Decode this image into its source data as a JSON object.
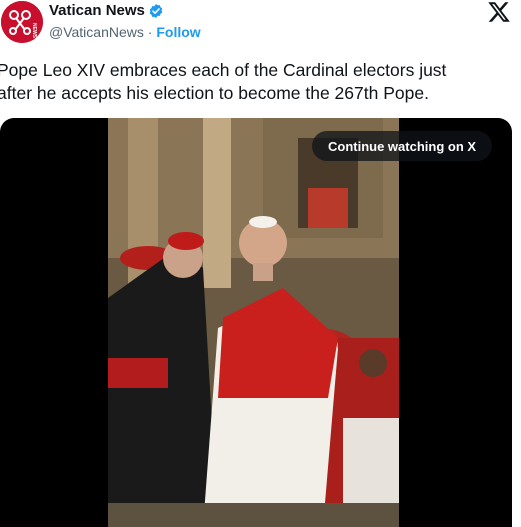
{
  "author": {
    "name": "Vatican News",
    "handle": "@VaticanNews",
    "separator": "·",
    "follow_label": "Follow",
    "verified_icon": "verified-badge-icon",
    "avatar_icon": "vatican-news-logo",
    "avatar_text": "NEWS"
  },
  "tweet": {
    "text": "Pope Leo XIV embraces each of the Cardinal electors just\nafter he accepts his election to become the 267th Pope."
  },
  "media": {
    "continue_label": "Continue watching on X"
  },
  "colors": {
    "brand_red": "#c8102e",
    "verified_blue": "#1d9bf0",
    "follow_blue": "#1d9bf0",
    "secondary_text": "#536471"
  },
  "icons": {
    "close": "x-logo-icon"
  }
}
